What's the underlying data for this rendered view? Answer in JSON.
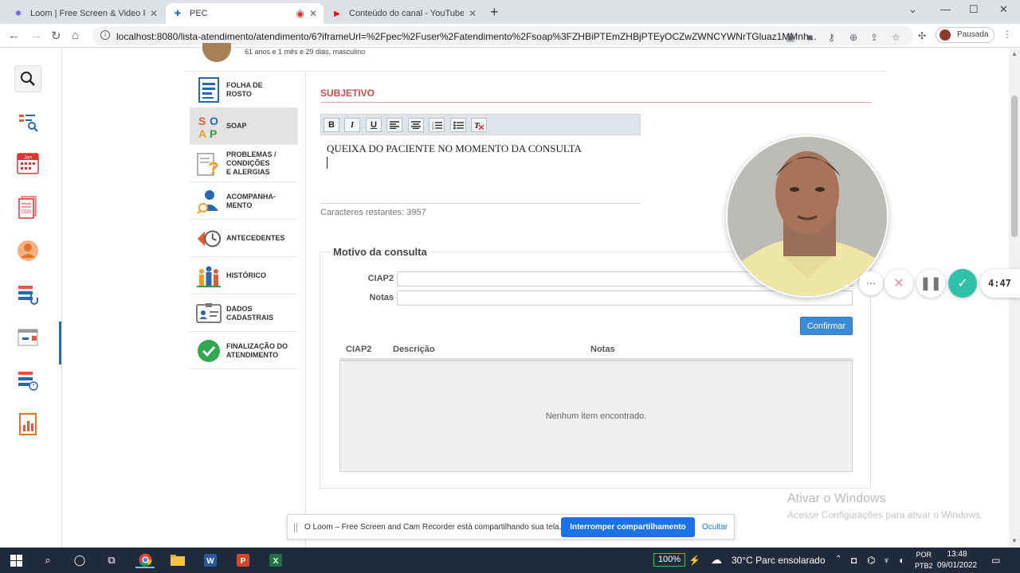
{
  "browser": {
    "tabs": [
      {
        "title": "Loom | Free Screen & Video Reco",
        "icon": "loom-icon"
      },
      {
        "title": "PEC",
        "icon": "pec-icon",
        "active": true
      },
      {
        "title": "Conteúdo do canal - YouTube Stu",
        "icon": "youtube-icon"
      }
    ],
    "url": "localhost:8080/lista-atendimento/atendimento/6?iframeUrl=%2Fpec%2Fuser%2Fatendimento%2Fsoap%3FZHBiPTEmZHBjPTEyOCZwZWNCYWNrTGluaz1MMnh...",
    "profile_label": "Pausada"
  },
  "rail": {
    "icons": [
      "search-icon",
      "patient-search-icon",
      "calendar-icon",
      "cds-icon",
      "user-icon",
      "attendance-list-icon",
      "schedule-icon",
      "timeline-icon",
      "reports-icon"
    ],
    "calendar_text": "Jan",
    "cds_text": "CDS"
  },
  "patient": {
    "info": "61 anos e 1 mês e 29 dias, masculino"
  },
  "menu": [
    {
      "label": "FOLHA DE\nROSTO",
      "icon": "document-icon"
    },
    {
      "label": "SOAP",
      "icon": "soap-icon",
      "active": true
    },
    {
      "label": "PROBLEMAS /\nCONDIÇÕES\nE ALERGIAS",
      "icon": "question-doc-icon"
    },
    {
      "label": "ACOMPANHA-\nMENTO",
      "icon": "person-monitor-icon"
    },
    {
      "label": "ANTECEDENTES",
      "icon": "history-clock-icon"
    },
    {
      "label": "HISTÓRICO",
      "icon": "family-icon"
    },
    {
      "label": "DADOS\nCADASTRAIS",
      "icon": "id-card-icon"
    },
    {
      "label": "FINALIZAÇÃO DO\nATENDIMENTO",
      "icon": "check-circle-icon"
    }
  ],
  "soap_letters": [
    "S",
    "O",
    "A",
    "P"
  ],
  "subjetivo": {
    "title": "SUBJETIVO",
    "editor_text": "QUEIXA DO PACIENTE NO MOMENTO DA CONSULTA",
    "chars_remaining": "Caracteres restantes: 3957",
    "toolbar": [
      "B",
      "I",
      "U",
      "align-left",
      "align-center",
      "ordered-list",
      "unordered-list",
      "clear-format"
    ]
  },
  "motivo": {
    "title": "Motivo da consulta",
    "ciap_label": "CIAP2",
    "notas_label": "Notas",
    "confirm_label": "Confirmar",
    "columns": [
      "CIAP2",
      "Descrição",
      "Notas"
    ],
    "empty_text": "Nenhum item encontrado."
  },
  "loom": {
    "timer": "4:47",
    "share_text": "O Loom – Free Screen and Cam Recorder está compartilhando sua tela.",
    "stop_label": "Interromper compartilhamento",
    "hide_label": "Ocultar"
  },
  "windows": {
    "watermark_title": "Ativar o Windows",
    "watermark_sub": "Acesse Configurações para ativar o Windows.",
    "battery": "100%",
    "weather": "30°C  Parc ensolarado",
    "lang_1": "POR",
    "lang_2": "PTB2",
    "time": "13:48",
    "date": "09/01/2022"
  },
  "colors": {
    "accent_blue": "#3a8ad6",
    "section_red": "#d04a4a",
    "loom_check": "#31c1a8",
    "loom_close": "#ef8f8f"
  }
}
